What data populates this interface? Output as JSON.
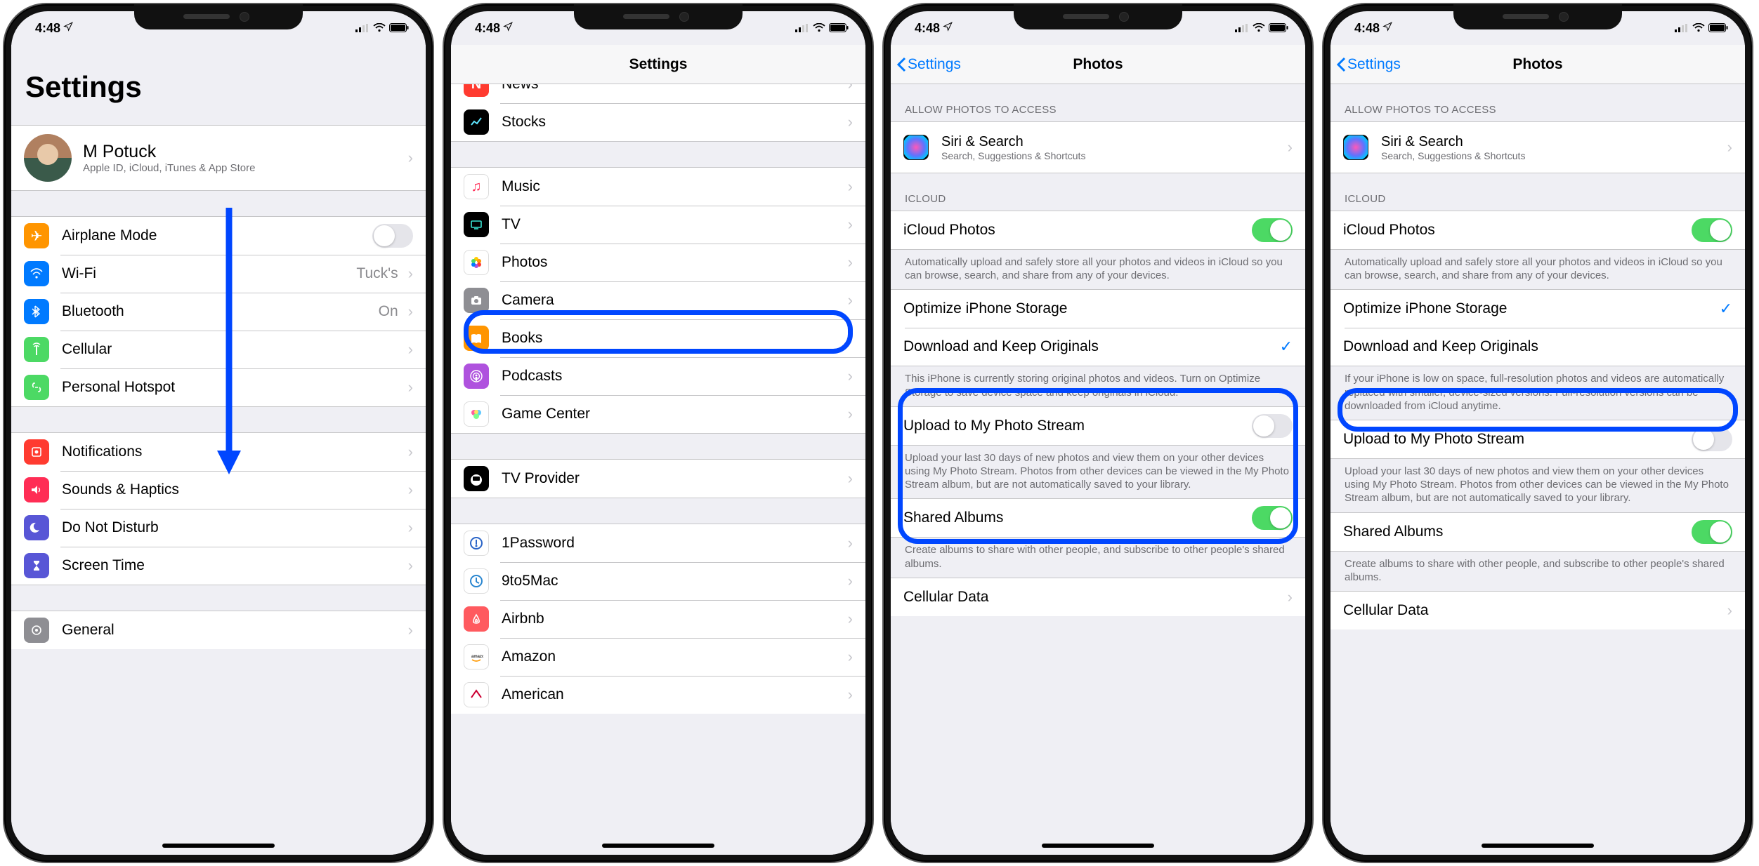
{
  "status": {
    "time": "4:48",
    "loc_glyph": "➤"
  },
  "screen1": {
    "title": "Settings",
    "profile": {
      "name": "M Potuck",
      "sub": "Apple ID, iCloud, iTunes & App Store"
    },
    "g1": [
      {
        "icon": "✈︎",
        "bg": "#ff9500",
        "label": "Airplane Mode",
        "toggle": "off"
      },
      {
        "icon": "wifi",
        "bg": "#007aff",
        "label": "Wi-Fi",
        "value": "Tuck's"
      },
      {
        "icon": "bt",
        "bg": "#007aff",
        "label": "Bluetooth",
        "value": "On"
      },
      {
        "icon": "ant",
        "bg": "#4cd964",
        "label": "Cellular"
      },
      {
        "icon": "link",
        "bg": "#4cd964",
        "label": "Personal Hotspot"
      }
    ],
    "g2": [
      {
        "icon": "bell",
        "bg": "#ff3b30",
        "label": "Notifications"
      },
      {
        "icon": "snd",
        "bg": "#ff2d55",
        "label": "Sounds & Haptics"
      },
      {
        "icon": "moon",
        "bg": "#5856d6",
        "label": "Do Not Disturb"
      },
      {
        "icon": "hour",
        "bg": "#5856d6",
        "label": "Screen Time"
      }
    ],
    "g3": [
      {
        "icon": "gear",
        "bg": "#8e8e93",
        "label": "General"
      }
    ]
  },
  "screen2": {
    "title": "Settings",
    "rows": [
      {
        "icon": "N",
        "bg": "#ff3b30",
        "label": "News"
      },
      {
        "icon": "stk",
        "bg": "#000",
        "label": "Stocks"
      }
    ],
    "rows2": [
      {
        "icon": "♫",
        "bg": "#fff",
        "fg": "#ff2d55",
        "label": "Music"
      },
      {
        "icon": "tv",
        "bg": "#000",
        "label": "TV"
      },
      {
        "icon": "ph",
        "bg": "#fff",
        "label": "Photos"
      },
      {
        "icon": "cam",
        "bg": "#8e8e93",
        "label": "Camera"
      },
      {
        "icon": "bk",
        "bg": "#ff9500",
        "label": "Books"
      },
      {
        "icon": "pod",
        "bg": "#af52de",
        "label": "Podcasts"
      },
      {
        "icon": "gc",
        "bg": "#fff",
        "label": "Game Center"
      }
    ],
    "rows3": [
      {
        "icon": "tvp",
        "bg": "#000",
        "label": "TV Provider"
      }
    ],
    "rows4": [
      {
        "icon": "1p",
        "bg": "#fff",
        "label": "1Password"
      },
      {
        "icon": "95",
        "bg": "#fff",
        "label": "9to5Mac"
      },
      {
        "icon": "ab",
        "bg": "#ff5a5f",
        "label": "Airbnb"
      },
      {
        "icon": "az",
        "bg": "#fff",
        "label": "Amazon"
      },
      {
        "icon": "am",
        "bg": "#fff",
        "label": "American"
      }
    ]
  },
  "screen3": {
    "back": "Settings",
    "title": "Photos",
    "allow_header": "ALLOW PHOTOS TO ACCESS",
    "siri": {
      "label": "Siri & Search",
      "sub": "Search, Suggestions & Shortcuts"
    },
    "icloud_header": "ICLOUD",
    "icloud_photos": "iCloud Photos",
    "icloud_footer": "Automatically upload and safely store all your photos and videos in iCloud so you can browse, search, and share from any of your devices.",
    "optimize": "Optimize iPhone Storage",
    "download": "Download and Keep Originals",
    "storage_footer": "This iPhone is currently storing original photos and videos. Turn on Optimize Storage to save device space and keep originals in iCloud.",
    "photostream": "Upload to My Photo Stream",
    "photostream_footer": "Upload your last 30 days of new photos and view them on your other devices using My Photo Stream. Photos from other devices can be viewed in the My Photo Stream album, but are not automatically saved to your library.",
    "shared": "Shared Albums",
    "shared_footer": "Create albums to share with other people, and subscribe to other people's shared albums.",
    "cellular": "Cellular Data"
  },
  "screen4": {
    "back": "Settings",
    "title": "Photos",
    "storage_footer": "If your iPhone is low on space, full-resolution photos and videos are automatically replaced with smaller, device-sized versions. Full-resolution versions can be downloaded from iCloud anytime."
  }
}
